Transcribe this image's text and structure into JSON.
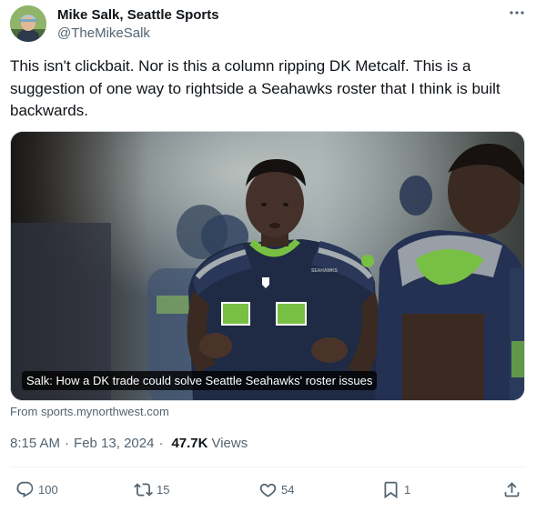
{
  "author": {
    "name": "Mike Salk, Seattle Sports",
    "handle": "@TheMikeSalk",
    "avatar_icon": "avatar-photo",
    "more_icon": "ellipsis-icon"
  },
  "tweet": {
    "text": "This isn't clickbait.  Nor is this a column ripping DK Metcalf.  This is a suggestion of one way to rightside a Seahawks roster that I think is built backwards."
  },
  "card": {
    "caption": "Salk: How a DK trade could solve Seattle Seahawks' roster issues",
    "source": "From sports.mynorthwest.com",
    "jersey_text": "SEAHAWKS",
    "colors": {
      "navy": "#1f2a44",
      "green": "#78c043",
      "grey": "#a5acaf"
    }
  },
  "meta": {
    "time": "8:15 AM",
    "separator": "·",
    "date": "Feb 13, 2024",
    "views_count": "47.7K",
    "views_label": "Views"
  },
  "actions": {
    "reply": {
      "icon": "reply-icon",
      "count": "100"
    },
    "retweet": {
      "icon": "retweet-icon",
      "count": "15"
    },
    "like": {
      "icon": "heart-icon",
      "count": "54"
    },
    "bookmark": {
      "icon": "bookmark-icon",
      "count": "1"
    },
    "share": {
      "icon": "share-icon"
    }
  },
  "colors": {
    "text_primary": "#0f1419",
    "text_secondary": "#536471",
    "divider": "#eff3f4"
  }
}
